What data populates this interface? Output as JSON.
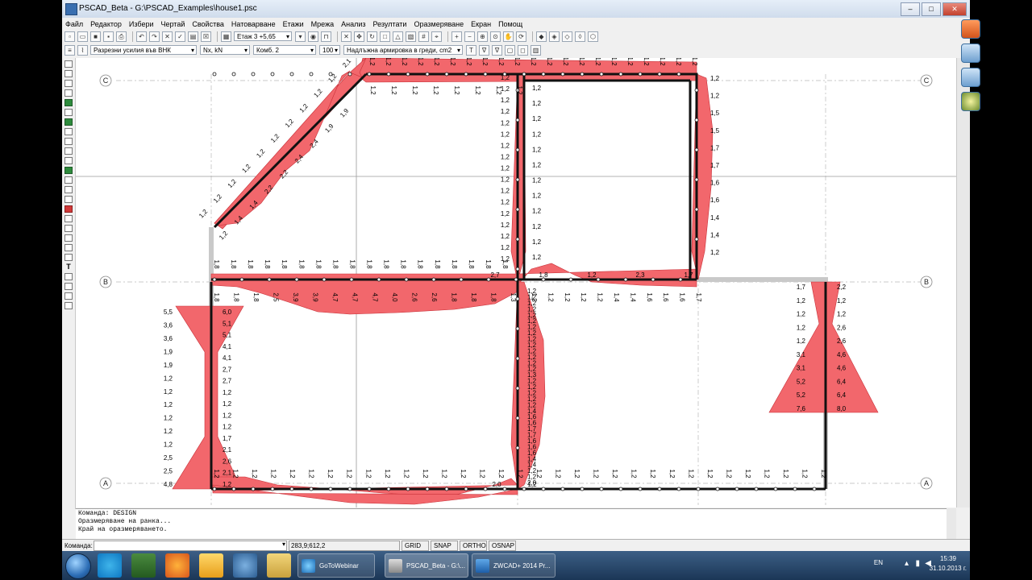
{
  "window": {
    "title": "PSCAD_Beta - G:\\PSCAD_Examples\\house1.psc",
    "min_label": "–",
    "max_label": "□",
    "close_label": "✕"
  },
  "menu": [
    "Файл",
    "Редактор",
    "Избери",
    "Чертай",
    "Свойства",
    "Натоварване",
    "Етажи",
    "Мрежа",
    "Анализ",
    "Резултати",
    "Оразмеряване",
    "Екран",
    "Помощ"
  ],
  "toolbar": {
    "floor_select": "Етаж 3 +5,65",
    "result_select": "Разрезни усилия във ВНК",
    "units_select": "Nx, kN",
    "combo_select": "Комб. 2",
    "scale_value": "100",
    "reinf_select": "Надлъжна армировка в греди, cm2"
  },
  "grid_axes": {
    "C": "C",
    "B": "B",
    "A": "A"
  },
  "labels": {
    "top_row": [
      "1,2",
      "1,2",
      "1,2",
      "1,2",
      "1,2",
      "1,2",
      "1,2",
      "1,2",
      "1,2",
      "1,2",
      "1,2",
      "1,2",
      "1,2",
      "1,2",
      "1,2",
      "1,2",
      "1,2",
      "1,2",
      "1,2",
      "1,2",
      "1,2"
    ],
    "inner_top": [
      "1,2",
      "1,2",
      "1,2",
      "1,2",
      "1,2",
      "1,2",
      "1,2",
      "1,2"
    ],
    "col_left_C": [
      "1,2",
      "1,2",
      "1,2",
      "1,2",
      "1,2",
      "1,2",
      "1,2",
      "1,2",
      "1,2",
      "1,2",
      "1,2",
      "1,2",
      "1,2",
      "1,2",
      "1,2",
      "1,2",
      "1,2"
    ],
    "col_right_C_vals": [
      "1,2",
      "1,2",
      "1,5",
      "1,5",
      "1,7",
      "1,7",
      "1,6",
      "1,6",
      "1,4",
      "1,4",
      "1,2"
    ],
    "col_right_C_inner": [
      "1,2",
      "1,2",
      "1,2",
      "1,2",
      "1,2",
      "1,2",
      "1,2",
      "1,2",
      "1,2",
      "1,2",
      "1,2",
      "1,2"
    ],
    "diag_outer": [
      "2,1",
      "1,2",
      "1,2",
      "1,2",
      "1,2",
      "1,2",
      "1,2",
      "1,2",
      "1,2",
      "1,2",
      "1,2"
    ],
    "diag_inner": [
      "1,9",
      "1,9",
      "2,4",
      "2,4",
      "2,2",
      "2,2",
      "1,4",
      "1,4",
      "1,2"
    ],
    "beamB_top": [
      "1,8",
      "1,8",
      "1,8",
      "1,8",
      "1,8",
      "1,8",
      "1,8",
      "1,8",
      "1,8",
      "1,8",
      "1,8",
      "1,8",
      "1,8",
      "1,8",
      "1,8",
      "1,8",
      "1,8",
      "1,8"
    ],
    "beamB_mid_vals": [
      "2,7",
      "1,8",
      "1,2",
      "2,3",
      "1,7"
    ],
    "beamB_bottom": [
      "1,8",
      "1,8",
      "1,8",
      "2,5",
      "3,9",
      "3,9",
      "4,7",
      "4,7",
      "4,7",
      "4,0",
      "2,6",
      "2,6",
      "1,8",
      "1,8",
      "1,8",
      "1,3"
    ],
    "beamB_right_bottom": [
      "1,2",
      "1,2",
      "1,2",
      "1,2",
      "1,2",
      "1,4",
      "1,4",
      "1,6",
      "1,6",
      "1,6",
      "1,7"
    ],
    "left_col_vals_out": [
      "5,5",
      "3,6",
      "3,6",
      "1,9",
      "1,9",
      "1,2",
      "1,2",
      "1,2",
      "1,2",
      "1,2",
      "1,2",
      "2,5",
      "2,5",
      "4,8"
    ],
    "left_col_vals_in": [
      "6,0",
      "5,1",
      "5,1",
      "4,1",
      "4,1",
      "2,7",
      "2,7",
      "1,2",
      "1,2",
      "1,2",
      "1,2",
      "1,7",
      "2,1",
      "2,6",
      "2,1",
      "1,2"
    ],
    "middle_col_vals": [
      "1,2",
      "1,2",
      "1,2",
      "1,2",
      "1,2",
      "1,2",
      "1,2",
      "1,2",
      "1,2",
      "1,2",
      "1,2",
      "1,2",
      "1,2",
      "1,2",
      "1,3",
      "1,2",
      "1,2",
      "1,2",
      "1,2",
      "1,2",
      "1,4",
      "1,6",
      "1,6",
      "1,7",
      "1,7",
      "1,6",
      "1,6",
      "1,6",
      "1,4",
      "1,4",
      "1,2",
      "1,2",
      "2,0"
    ],
    "right_col_vals_left": [
      "1,7",
      "1,2",
      "1,2",
      "1,2",
      "1,2",
      "3,1",
      "3,1",
      "5,2",
      "5,2",
      "7,6"
    ],
    "right_col_vals_right": [
      "2,2",
      "1,2",
      "1,2",
      "2,6",
      "2,6",
      "4,6",
      "4,6",
      "6,4",
      "6,4",
      "8,0"
    ],
    "beamA_top": [
      "1,2",
      "1,2",
      "1,2",
      "1,2",
      "1,2",
      "1,2",
      "1,2",
      "1,2",
      "1,2",
      "1,2",
      "1,2",
      "1,2",
      "1,2",
      "1,2",
      "1,2",
      "1,2",
      "1,2",
      "1,2",
      "1,2",
      "1,2",
      "1,2",
      "1,2",
      "1,2",
      "1,2",
      "1,2",
      "1,2",
      "1,2",
      "1,2",
      "1,2",
      "1,2",
      "1,2",
      "1,2",
      "1,2"
    ],
    "beamA_mid": [
      "2,0",
      "1,2"
    ]
  },
  "command_log": [
    "Команда: DESIGN",
    "Оразмеряване на ранка...",
    "Край на оразмеряването."
  ],
  "status": {
    "cmd_label": "Команда:",
    "coords": "283,9;612,2",
    "grid": "GRID",
    "snap": "SNAP",
    "ortho": "ORTHO",
    "osnap": "OSNAP"
  },
  "taskbar": {
    "tasks": [
      "GoToWebinar",
      "PSCAD_Beta - G:\\...",
      "ZWCAD+ 2014 Pr..."
    ],
    "lang": "EN",
    "time": "15:39",
    "date": "31.10.2013 г."
  },
  "colors": {
    "diagram_fill": "#f2676c",
    "diagram_stroke": "#c83038",
    "beam": "#111111",
    "grid_line": "#b0b0b0"
  }
}
